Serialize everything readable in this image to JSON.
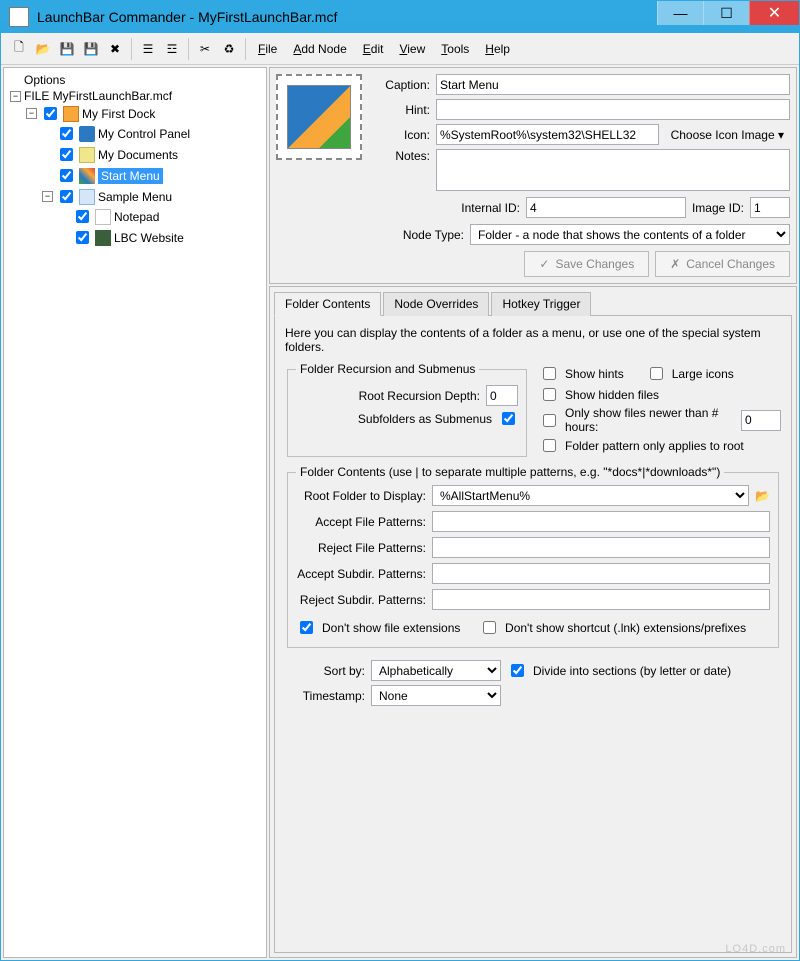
{
  "title": "LaunchBar Commander - MyFirstLaunchBar.mcf",
  "menu": {
    "file": "File",
    "add_node": "Add Node",
    "edit": "Edit",
    "view": "View",
    "tools": "Tools",
    "help": "Help"
  },
  "tree": {
    "options": "Options",
    "file": "FILE MyFirstLaunchBar.mcf",
    "dock": "My First Dock",
    "items": {
      "cp": "My Control Panel",
      "docs": "My Documents",
      "sm": "Start Menu",
      "sample": "Sample Menu",
      "np": "Notepad",
      "web": "LBC Website"
    }
  },
  "props": {
    "caption_label": "Caption:",
    "caption": "Start Menu",
    "hint_label": "Hint:",
    "hint": "",
    "icon_label": "Icon:",
    "icon": "%SystemRoot%\\system32\\SHELL32",
    "choose_icon": "Choose Icon Image",
    "notes_label": "Notes:",
    "notes": "",
    "internal_id_label": "Internal ID:",
    "internal_id": "4",
    "image_id_label": "Image ID:",
    "image_id": "1",
    "node_type_label": "Node Type:",
    "node_type": "Folder - a node that shows the contents of a folder",
    "save": "Save Changes",
    "cancel": "Cancel Changes"
  },
  "tabs": {
    "folder": "Folder Contents",
    "overrides": "Node Overrides",
    "hotkey": "Hotkey Trigger"
  },
  "fc": {
    "help": "Here you can display the contents of a folder as a menu, or use one of the special system folders.",
    "recursion_legend": "Folder Recursion and Submenus",
    "root_depth_label": "Root Recursion Depth:",
    "root_depth": "0",
    "subfolders_label": "Subfolders as Submenus",
    "show_hints": "Show hints",
    "large_icons": "Large icons",
    "show_hidden": "Show hidden files",
    "only_newer": "Only show files newer than # hours:",
    "only_newer_val": "0",
    "pattern_root_only": "Folder pattern only applies to root",
    "fc_legend": "Folder Contents (use | to separate multiple patterns, e.g. \"*docs*|*downloads*\")",
    "root_folder_label": "Root Folder to Display:",
    "root_folder": "%AllStartMenu%",
    "accept_files_label": "Accept File Patterns:",
    "reject_files_label": "Reject File Patterns:",
    "accept_subdir_label": "Accept Subdir. Patterns:",
    "reject_subdir_label": "Reject Subdir. Patterns:",
    "no_ext": "Don't show file extensions",
    "no_lnk": "Don't show shortcut (.lnk) extensions/prefixes",
    "sort_label": "Sort by:",
    "sort": "Alphabetically",
    "divide": "Divide into sections (by letter or date)",
    "timestamp_label": "Timestamp:",
    "timestamp": "None"
  },
  "watermark": "LO4D.com"
}
